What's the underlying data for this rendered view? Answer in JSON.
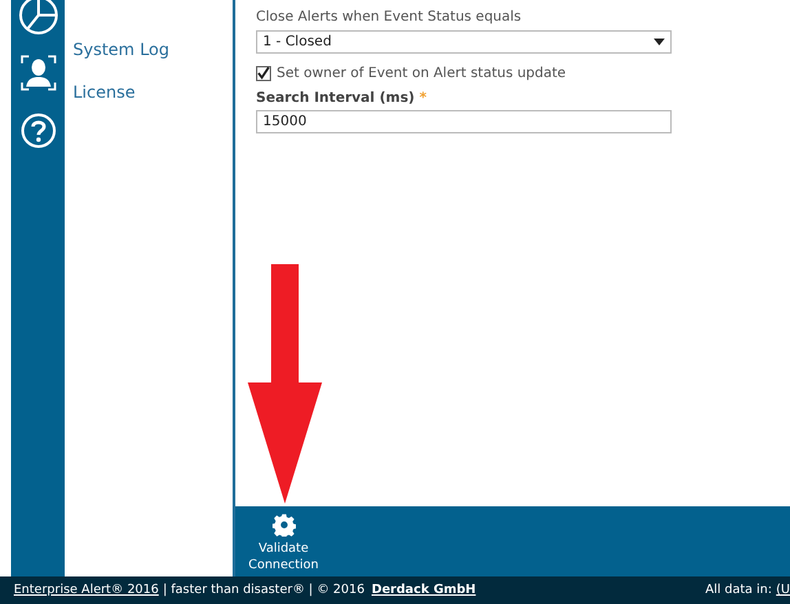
{
  "nav": {
    "items": [
      {
        "label": "System Log"
      },
      {
        "label": "License"
      }
    ]
  },
  "form": {
    "status_label": "Close Alerts when Event Status equals",
    "status_value": "1 - Closed",
    "owner_checkbox": {
      "label": "Set owner of Event on Alert status update",
      "checked": true
    },
    "interval": {
      "label": "Search Interval (ms)",
      "required_mark": "*",
      "value": "15000"
    }
  },
  "toolbar": {
    "buttons": [
      {
        "label": "Validate Connection"
      }
    ]
  },
  "footer": {
    "product_link": "Enterprise Alert® 2016",
    "tagline": "| faster than disaster® | © 2016",
    "company_link": "Derdack GmbH",
    "data_note": "All data in:",
    "data_link": "(U"
  }
}
